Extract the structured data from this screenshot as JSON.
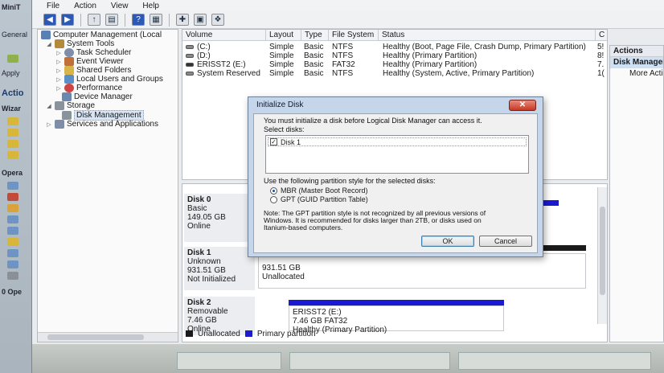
{
  "bg_app": {
    "title": "MiniT",
    "tab": "General",
    "apply": "Apply",
    "actions": "Actio",
    "wizard": "Wizar",
    "operations": "Opera",
    "pending": "0 Ope"
  },
  "menu": [
    "File",
    "Action",
    "View",
    "Help"
  ],
  "tree": {
    "root": "Computer Management (Local",
    "system_tools": "System Tools",
    "task_scheduler": "Task Scheduler",
    "event_viewer": "Event Viewer",
    "shared_folders": "Shared Folders",
    "local_users": "Local Users and Groups",
    "performance": "Performance",
    "device_manager": "Device Manager",
    "storage": "Storage",
    "disk_management": "Disk Management",
    "services": "Services and Applications"
  },
  "volumes": {
    "headers": [
      "Volume",
      "Layout",
      "Type",
      "File System",
      "Status",
      "C"
    ],
    "rows": [
      {
        "volume": "(C:)",
        "layout": "Simple",
        "type": "Basic",
        "fs": "NTFS",
        "status": "Healthy (Boot, Page File, Crash Dump, Primary Partition)",
        "cap": "5!"
      },
      {
        "volume": "(D:)",
        "layout": "Simple",
        "type": "Basic",
        "fs": "NTFS",
        "status": "Healthy (Primary Partition)",
        "cap": "8!"
      },
      {
        "volume": "ERISST2 (E:)",
        "layout": "Simple",
        "type": "Basic",
        "fs": "FAT32",
        "status": "Healthy (Primary Partition)",
        "cap": "7."
      },
      {
        "volume": "System Reserved",
        "layout": "Simple",
        "type": "Basic",
        "fs": "NTFS",
        "status": "Healthy (System, Active, Primary Partition)",
        "cap": "1("
      }
    ]
  },
  "disks": {
    "disk0": {
      "name": "Disk 0",
      "type": "Basic",
      "size": "149.05 GB",
      "state": "Online"
    },
    "disk1": {
      "name": "Disk 1",
      "type": "Unknown",
      "size": "931.51 GB",
      "state": "Not Initialized",
      "part_size": "931.51 GB",
      "part_state": "Unallocated"
    },
    "disk2": {
      "name": "Disk 2",
      "type": "Removable",
      "size": "7.46 GB",
      "state": "Online",
      "part_name": "ERISST2  (E:)",
      "part_size": "7.46 GB FAT32",
      "part_state": "Healthy (Primary Partition)"
    }
  },
  "legend": {
    "unallocated": "Unallocated",
    "primary": "Primary partition"
  },
  "actions": {
    "header": "Actions",
    "section": "Disk Managem",
    "more": "More Actio"
  },
  "dialog": {
    "title": "Initialize Disk",
    "intro": "You must initialize a disk before Logical Disk Manager can access it.",
    "select_label": "Select disks:",
    "disk_item": "Disk 1",
    "style_label": "Use the following partition style for the selected disks:",
    "mbr": "MBR (Master Boot Record)",
    "gpt": "GPT (GUID Partition Table)",
    "note_1": "Note: The GPT partition style is not recognized by all previous versions of",
    "note_2": "Windows. It is recommended for disks larger than 2TB, or disks used on",
    "note_3": "Itanium-based computers.",
    "ok": "OK",
    "cancel": "Cancel"
  },
  "colors": {
    "primary_partition": "#1a1ad0",
    "unallocated": "#1a1a1a",
    "dialog_frame": "#c6d6ea"
  }
}
